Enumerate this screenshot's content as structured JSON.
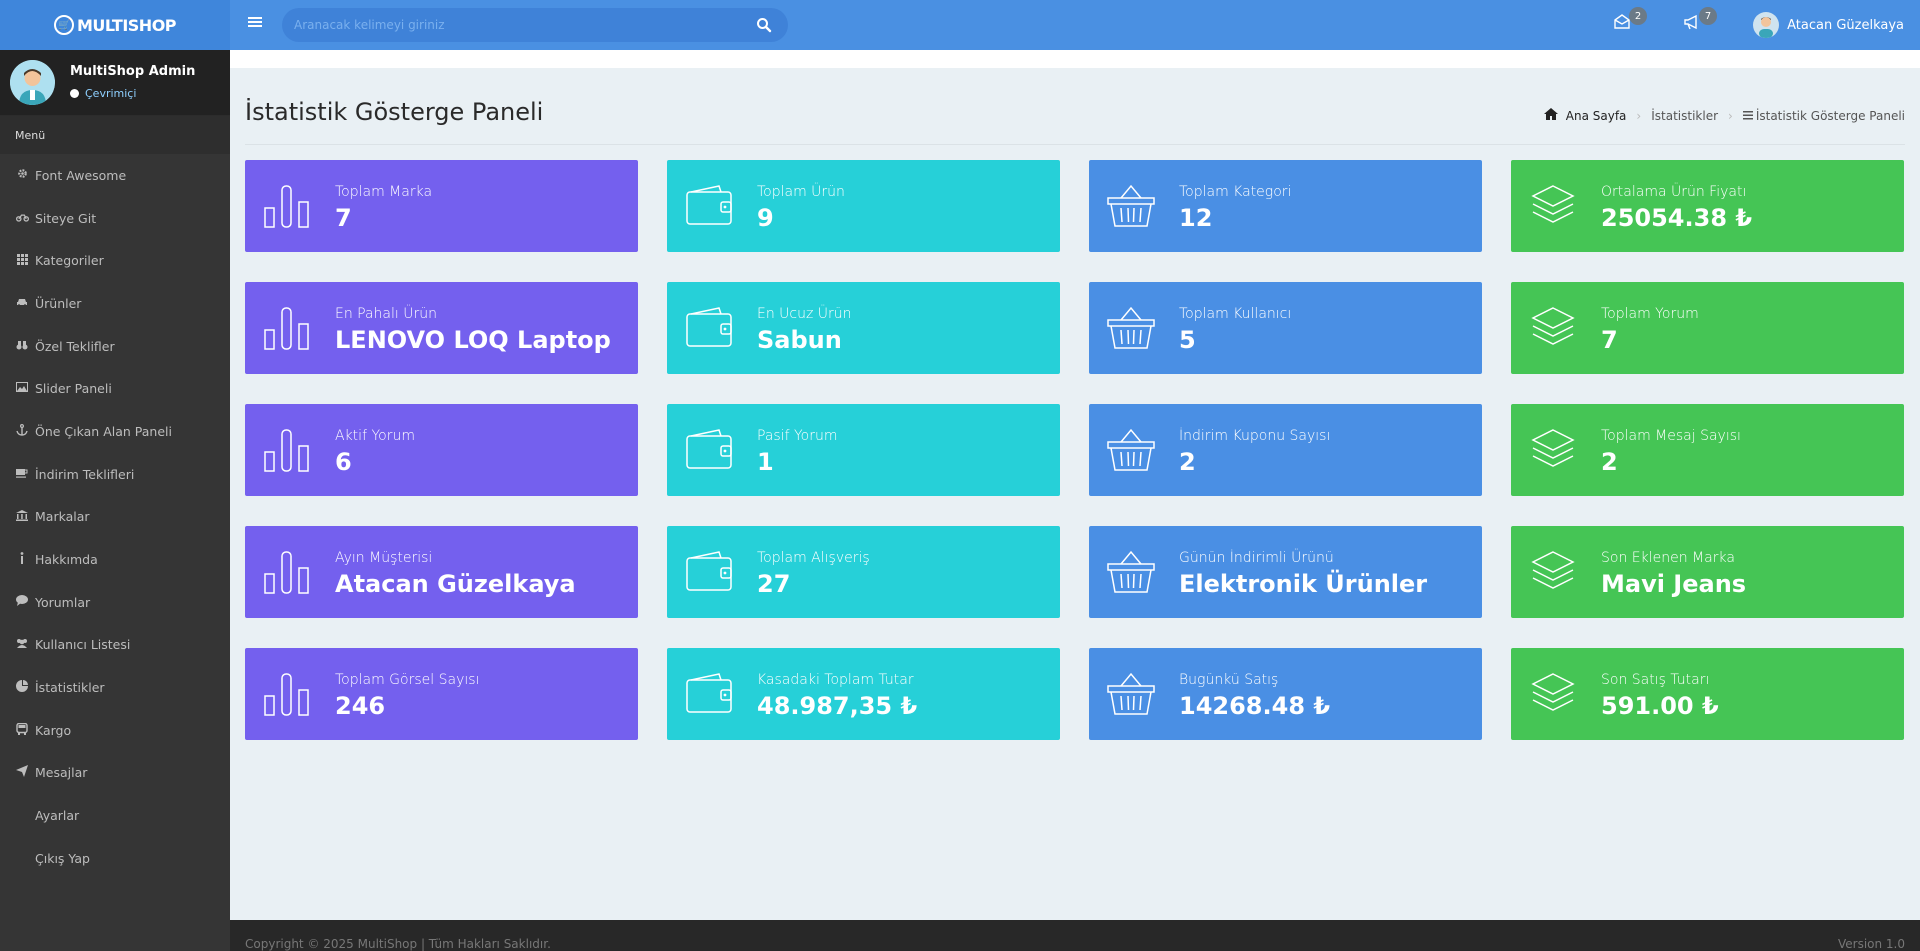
{
  "brand": {
    "name": "MULTISHOP"
  },
  "topbar": {
    "search_placeholder": "Aranacak kelimeyi giriniz",
    "mail_count": "2",
    "notif_count": "7",
    "user_name": "Atacan Güzelkaya"
  },
  "sidebar": {
    "admin_name": "MultiShop Admin",
    "status": "Çevrimiçi",
    "menu_header": "Menü",
    "items": [
      {
        "label": "Font Awesome",
        "icon": "gear-icon"
      },
      {
        "label": "Siteye Git",
        "icon": "motorcycle-icon"
      },
      {
        "label": "Kategoriler",
        "icon": "grid-icon"
      },
      {
        "label": "Ürünler",
        "icon": "car-icon"
      },
      {
        "label": "Özel Teklifler",
        "icon": "binoculars-icon"
      },
      {
        "label": "Slider Paneli",
        "icon": "image-icon"
      },
      {
        "label": "Öne Çıkan Alan Paneli",
        "icon": "anchor-icon"
      },
      {
        "label": "İndirim Teklifleri",
        "icon": "coffee-icon"
      },
      {
        "label": "Markalar",
        "icon": "bank-icon"
      },
      {
        "label": "Hakkımda",
        "icon": "info-icon"
      },
      {
        "label": "Yorumlar",
        "icon": "comment-icon"
      },
      {
        "label": "Kullanıcı Listesi",
        "icon": "users-icon"
      },
      {
        "label": "İstatistikler",
        "icon": "pie-chart-icon"
      },
      {
        "label": "Kargo",
        "icon": "bus-icon"
      },
      {
        "label": "Mesajlar",
        "icon": "paper-plane-icon"
      },
      {
        "label": "Ayarlar",
        "icon": ""
      },
      {
        "label": "Çıkış Yap",
        "icon": ""
      }
    ]
  },
  "page": {
    "title": "İstatistik Gösterge Paneli",
    "breadcrumb": [
      "Ana Sayfa",
      "İstatistikler",
      "İstatistik Gösterge Paneli"
    ]
  },
  "colors": {
    "purple": "#7460ee",
    "cyan": "#26d0d8",
    "blue": "#4a8fe4",
    "green": "#45c555"
  },
  "cards": [
    [
      {
        "label": "Toplam Marka",
        "value": "7",
        "icon": "bar-chart-icon",
        "color": "purple"
      },
      {
        "label": "Toplam Ürün",
        "value": "9",
        "icon": "wallet-icon",
        "color": "cyan"
      },
      {
        "label": "Toplam Kategori",
        "value": "12",
        "icon": "basket-icon",
        "color": "blue"
      },
      {
        "label": "Ortalama Ürün Fiyatı",
        "value": "25054.38 ₺",
        "icon": "layers-icon",
        "color": "green"
      }
    ],
    [
      {
        "label": "En Pahalı Ürün",
        "value": "LENOVO LOQ Laptop",
        "icon": "bar-chart-icon",
        "color": "purple"
      },
      {
        "label": "En Ucuz Ürün",
        "value": "Sabun",
        "icon": "wallet-icon",
        "color": "cyan"
      },
      {
        "label": "Toplam Kullanıcı",
        "value": "5",
        "icon": "basket-icon",
        "color": "blue"
      },
      {
        "label": "Toplam Yorum",
        "value": "7",
        "icon": "layers-icon",
        "color": "green"
      }
    ],
    [
      {
        "label": "Aktif Yorum",
        "value": "6",
        "icon": "bar-chart-icon",
        "color": "purple"
      },
      {
        "label": "Pasif Yorum",
        "value": "1",
        "icon": "wallet-icon",
        "color": "cyan"
      },
      {
        "label": "İndirim Kuponu Sayısı",
        "value": "2",
        "icon": "basket-icon",
        "color": "blue"
      },
      {
        "label": "Toplam Mesaj Sayısı",
        "value": "2",
        "icon": "layers-icon",
        "color": "green"
      }
    ],
    [
      {
        "label": "Ayın Müşterisi",
        "value": "Atacan Güzelkaya",
        "icon": "bar-chart-icon",
        "color": "purple"
      },
      {
        "label": "Toplam Alışveriş",
        "value": "27",
        "icon": "wallet-icon",
        "color": "cyan"
      },
      {
        "label": "Günün İndirimli Ürünü",
        "value": "Elektronik Ürünler",
        "icon": "basket-icon",
        "color": "blue"
      },
      {
        "label": "Son Eklenen Marka",
        "value": "Mavi Jeans",
        "icon": "layers-icon",
        "color": "green"
      }
    ],
    [
      {
        "label": "Toplam Görsel Sayısı",
        "value": "246",
        "icon": "bar-chart-icon",
        "color": "purple"
      },
      {
        "label": "Kasadaki Toplam Tutar",
        "value": "48.987,35 ₺",
        "icon": "wallet-icon",
        "color": "cyan"
      },
      {
        "label": "Bugünkü Satış",
        "value": "14268.48 ₺",
        "icon": "basket-icon",
        "color": "blue"
      },
      {
        "label": "Son Satış Tutarı",
        "value": "591.00 ₺",
        "icon": "layers-icon",
        "color": "green"
      }
    ]
  ],
  "footer": {
    "copyright": "Copyright © 2025 MultiShop | Tüm Hakları Saklıdır.",
    "version": "Version 1.0"
  }
}
